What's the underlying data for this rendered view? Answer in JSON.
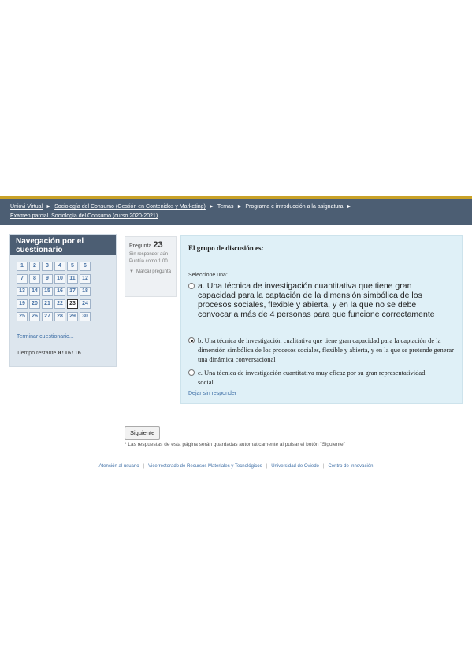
{
  "breadcrumb": {
    "items": [
      "Uniovi Virtual",
      "Sociología del Consumo (Gestión en Contenidos y Marketing)",
      "Temas",
      "Programa e introducción a la asignatura",
      "Examen parcial. Sociología del Consumo (curso 2020-2021)"
    ]
  },
  "nav": {
    "title": "Navegación por el cuestionario",
    "questions": [
      "1",
      "2",
      "3",
      "4",
      "5",
      "6",
      "7",
      "8",
      "9",
      "10",
      "11",
      "12",
      "13",
      "14",
      "15",
      "16",
      "17",
      "18",
      "19",
      "20",
      "21",
      "22",
      "23",
      "24",
      "25",
      "26",
      "27",
      "28",
      "29",
      "30"
    ],
    "current": "23",
    "finish_label": "Terminar cuestionario...",
    "timer_label": "Tiempo restante",
    "timer_value": "0:16:16"
  },
  "question_info": {
    "label": "Pregunta",
    "number": "23",
    "state": "Sin responder aún",
    "grade": "Puntúa como 1,00",
    "flag_label": "Marcar pregunta"
  },
  "question": {
    "text": "El grupo de discusión es:",
    "prompt": "Seleccione una:",
    "answers": [
      {
        "letter": "a.",
        "text": "Una técnica de investigación cuantitativa que tiene gran capacidad para la captación de la dimensión simbólica de los procesos sociales, flexible y abierta, y en la que no se debe convocar a más de 4 personas para que funcione correctamente",
        "checked": false
      },
      {
        "letter": "b.",
        "text": "Una técnica de investigación cualitativa que tiene gran capacidad para la captación de la dimensión simbólica de los procesos sociales, flexible y abierta, y en la que se pretende generar una dinámica conversacional",
        "checked": true
      },
      {
        "letter": "c.",
        "text": "Una técnica de investigación cuantitativa muy eficaz por su gran representatividad social",
        "checked": false
      }
    ],
    "clear_label": "Dejar sin responder"
  },
  "next": {
    "button_label": "Siguiente",
    "note": "* Las respuestas de esta página serán guardadas automáticamente al pulsar el botón \"Siguiente\""
  },
  "footer": {
    "links": [
      "Atención al usuario",
      "Vicerrectorado de Recursos Materiales y Tecnológicos",
      "Universidad de Oviedo",
      "Centro de Innovación"
    ]
  },
  "colors": {
    "header_bar": "#4c5e73",
    "accent_line": "#c9a227",
    "question_bg": "#dff0f7",
    "link": "#3e6fa6"
  }
}
